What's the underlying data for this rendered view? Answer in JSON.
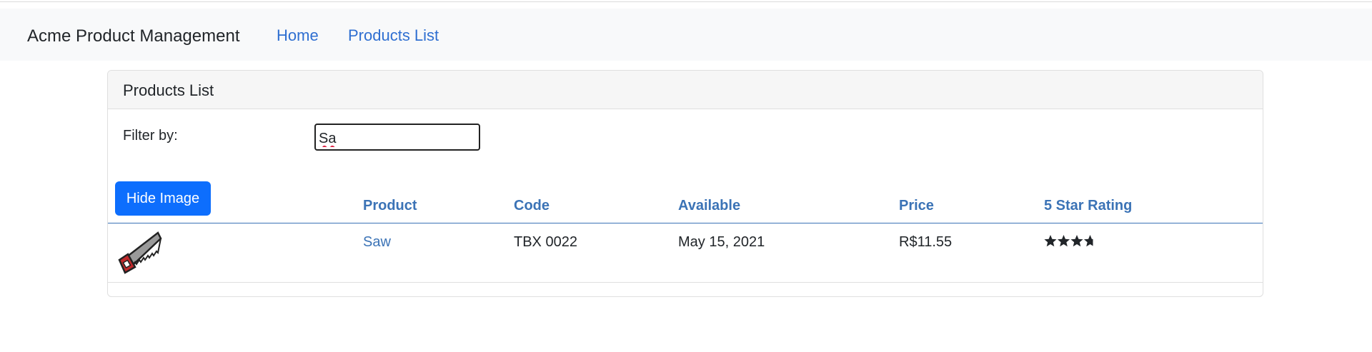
{
  "navbar": {
    "brand": "Acme Product Management",
    "links": [
      "Home",
      "Products List"
    ]
  },
  "card": {
    "title": "Products List",
    "filter_label": "Filter by:",
    "filter_value": "Sa",
    "toggle_image_label": "Hide Image"
  },
  "table": {
    "headers": [
      "Product",
      "Code",
      "Available",
      "Price",
      "5 Star Rating"
    ],
    "rows": [
      {
        "image_icon": "saw-icon",
        "product": "Saw",
        "code": "TBX 0022",
        "available": "May 15, 2021",
        "price": "R$11.55",
        "rating": 3.7
      }
    ]
  },
  "colors": {
    "link": "#2f6fd1",
    "header_text": "#3b73b6",
    "button": "#0d6efd",
    "navbar_bg": "#f8f9fa"
  }
}
